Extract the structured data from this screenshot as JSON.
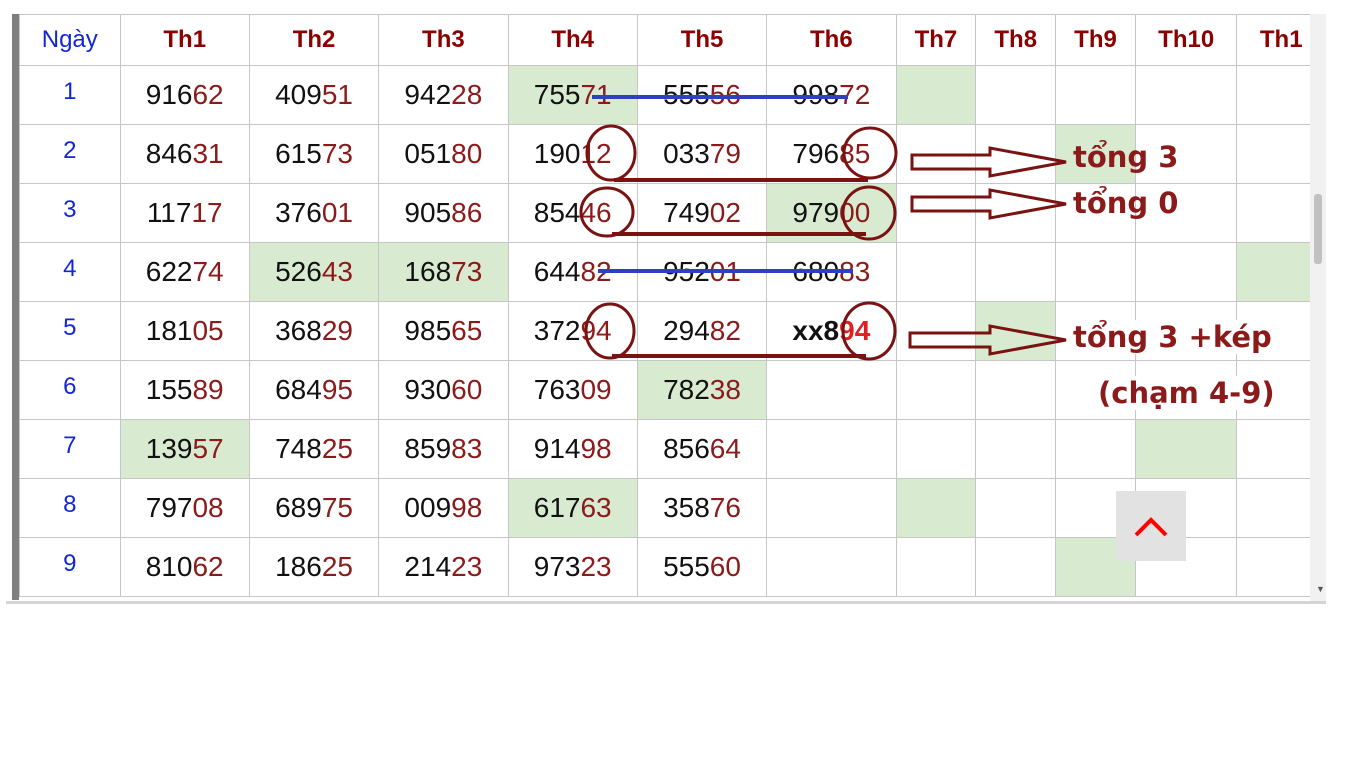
{
  "table": {
    "headers": [
      "Ngày",
      "Th1",
      "Th2",
      "Th3",
      "Th4",
      "Th5",
      "Th6",
      "Th7",
      "Th8",
      "Th9",
      "Th10",
      "Th1"
    ],
    "rows": [
      {
        "day": "1",
        "cells": [
          {
            "h": "916",
            "t": "62"
          },
          {
            "h": "409",
            "t": "51"
          },
          {
            "h": "942",
            "t": "28"
          },
          {
            "h": "755",
            "t": "71",
            "hl": true
          },
          {
            "h": "555",
            "t": "56"
          },
          {
            "h": "998",
            "t": "72"
          },
          {
            "e": true,
            "hl": true
          },
          {
            "e": true
          },
          {
            "e": true
          },
          {
            "e": true
          },
          {
            "e": true
          }
        ]
      },
      {
        "day": "2",
        "cells": [
          {
            "h": "846",
            "t": "31"
          },
          {
            "h": "615",
            "t": "73"
          },
          {
            "h": "051",
            "t": "80"
          },
          {
            "h": "190",
            "t": "12"
          },
          {
            "h": "033",
            "t": "79"
          },
          {
            "h": "796",
            "t": "85"
          },
          {
            "e": true
          },
          {
            "e": true
          },
          {
            "e": true,
            "hl": true
          },
          {
            "e": true
          },
          {
            "e": true
          }
        ]
      },
      {
        "day": "3",
        "cells": [
          {
            "h": "117",
            "t": "17"
          },
          {
            "h": "376",
            "t": "01"
          },
          {
            "h": "905",
            "t": "86"
          },
          {
            "h": "854",
            "t": "46"
          },
          {
            "h": "749",
            "t": "02"
          },
          {
            "h": "979",
            "t": "00",
            "hl": true
          },
          {
            "e": true
          },
          {
            "e": true
          },
          {
            "e": true
          },
          {
            "e": true
          },
          {
            "e": true
          }
        ]
      },
      {
        "day": "4",
        "cells": [
          {
            "h": "622",
            "t": "74"
          },
          {
            "h": "526",
            "t": "43",
            "hl": true
          },
          {
            "h": "168",
            "t": "73",
            "hl": true
          },
          {
            "h": "644",
            "t": "82"
          },
          {
            "h": "952",
            "t": "01"
          },
          {
            "h": "680",
            "t": "83"
          },
          {
            "e": true
          },
          {
            "e": true
          },
          {
            "e": true
          },
          {
            "e": true
          },
          {
            "e": true,
            "hl": true
          }
        ]
      },
      {
        "day": "5",
        "cells": [
          {
            "h": "181",
            "t": "05"
          },
          {
            "h": "368",
            "t": "29"
          },
          {
            "h": "985",
            "t": "65"
          },
          {
            "h": "372",
            "t": "94"
          },
          {
            "h": "294",
            "t": "82"
          },
          {
            "h": "xx8",
            "t": "94",
            "special": true
          },
          {
            "e": true
          },
          {
            "e": true,
            "hl": true
          },
          {
            "e": true
          },
          {
            "e": true
          },
          {
            "e": true
          }
        ]
      },
      {
        "day": "6",
        "cells": [
          {
            "h": "155",
            "t": "89"
          },
          {
            "h": "684",
            "t": "95"
          },
          {
            "h": "930",
            "t": "60"
          },
          {
            "h": "763",
            "t": "09"
          },
          {
            "h": "782",
            "t": "38",
            "hl": true
          },
          {
            "e": true
          },
          {
            "e": true
          },
          {
            "e": true
          },
          {
            "e": true
          },
          {
            "e": true
          },
          {
            "e": true
          }
        ]
      },
      {
        "day": "7",
        "cells": [
          {
            "h": "139",
            "t": "57",
            "hl": true
          },
          {
            "h": "748",
            "t": "25"
          },
          {
            "h": "859",
            "t": "83"
          },
          {
            "h": "914",
            "t": "98"
          },
          {
            "h": "856",
            "t": "64"
          },
          {
            "e": true
          },
          {
            "e": true
          },
          {
            "e": true
          },
          {
            "e": true
          },
          {
            "e": true,
            "hl": true
          },
          {
            "e": true
          }
        ]
      },
      {
        "day": "8",
        "cells": [
          {
            "h": "797",
            "t": "08"
          },
          {
            "h": "689",
            "t": "75"
          },
          {
            "h": "009",
            "t": "98"
          },
          {
            "h": "617",
            "t": "63",
            "hl": true
          },
          {
            "h": "358",
            "t": "76"
          },
          {
            "e": true
          },
          {
            "e": true,
            "hl": true
          },
          {
            "e": true
          },
          {
            "e": true
          },
          {
            "e": true
          },
          {
            "e": true
          }
        ]
      },
      {
        "day": "9",
        "cells": [
          {
            "h": "810",
            "t": "62"
          },
          {
            "h": "186",
            "t": "25"
          },
          {
            "h": "214",
            "t": "23"
          },
          {
            "h": "973",
            "t": "23"
          },
          {
            "h": "555",
            "t": "60"
          },
          {
            "e": true
          },
          {
            "e": true
          },
          {
            "e": true
          },
          {
            "e": true,
            "hl": true
          },
          {
            "e": true
          },
          {
            "e": true
          }
        ]
      }
    ]
  },
  "annotations": {
    "note1": "tổng 3",
    "note2": "tổng 0",
    "note3": "tổng 3 +kép",
    "note4": "(chạm 4-9)"
  },
  "colors": {
    "highlight": "#d8ead0",
    "annotation": "#8b1a1a",
    "strike": "#2e3fbf",
    "day_number": "#1226d4",
    "up_arrow": "#ff0000"
  },
  "icons": {
    "back_to_top": "chevron-up-icon"
  }
}
